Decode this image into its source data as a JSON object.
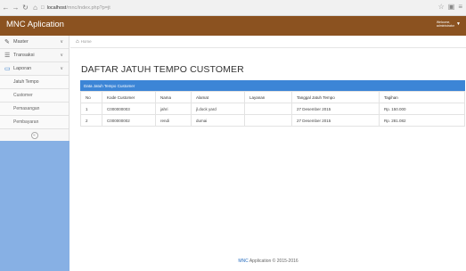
{
  "browser": {
    "host": "localhost",
    "path": "/mnc/index.php?p=jt",
    "back_icon": "arrow-left",
    "forward_icon": "arrow-right",
    "reload_icon": "reload",
    "home_icon": "home",
    "page_icon": "page",
    "star_icon": "star",
    "menu_icon": "menu"
  },
  "header": {
    "brand": "MNC Aplication",
    "user_line1": "Welcome,",
    "user_line2": "administrator"
  },
  "sidebar": {
    "items": [
      {
        "label": "Master",
        "icon": "edit-icon"
      },
      {
        "label": "Transaksi",
        "icon": "list-icon"
      },
      {
        "label": "Laporan",
        "icon": "monitor-icon"
      }
    ],
    "subitems": [
      "Jatuh Tempo",
      "Customer",
      "Pemasangan",
      "Pembayaran"
    ]
  },
  "breadcrumb": {
    "label": "Home"
  },
  "main": {
    "title": "DAFTAR JATUH TEMPO CUSTOMER",
    "panel_title": "Data Jatuh Tempo Customer",
    "columns": [
      "No",
      "Kode Customer",
      "Nama",
      "Alamat",
      "Layanan",
      "Tanggal Jatuh Tempo",
      "Tagihan"
    ],
    "rows": [
      [
        "1",
        "C000000003",
        "jahri",
        "jl.dock yard",
        "",
        "27 Desember 2015",
        "Rp. 150.000"
      ],
      [
        "2",
        "C000000002",
        "rendi",
        "dumai",
        "",
        "27 Desember 2015",
        "Rp. 281.082"
      ]
    ]
  },
  "footer": {
    "brand": "MNC",
    "text": "Application © 2015-2016"
  }
}
